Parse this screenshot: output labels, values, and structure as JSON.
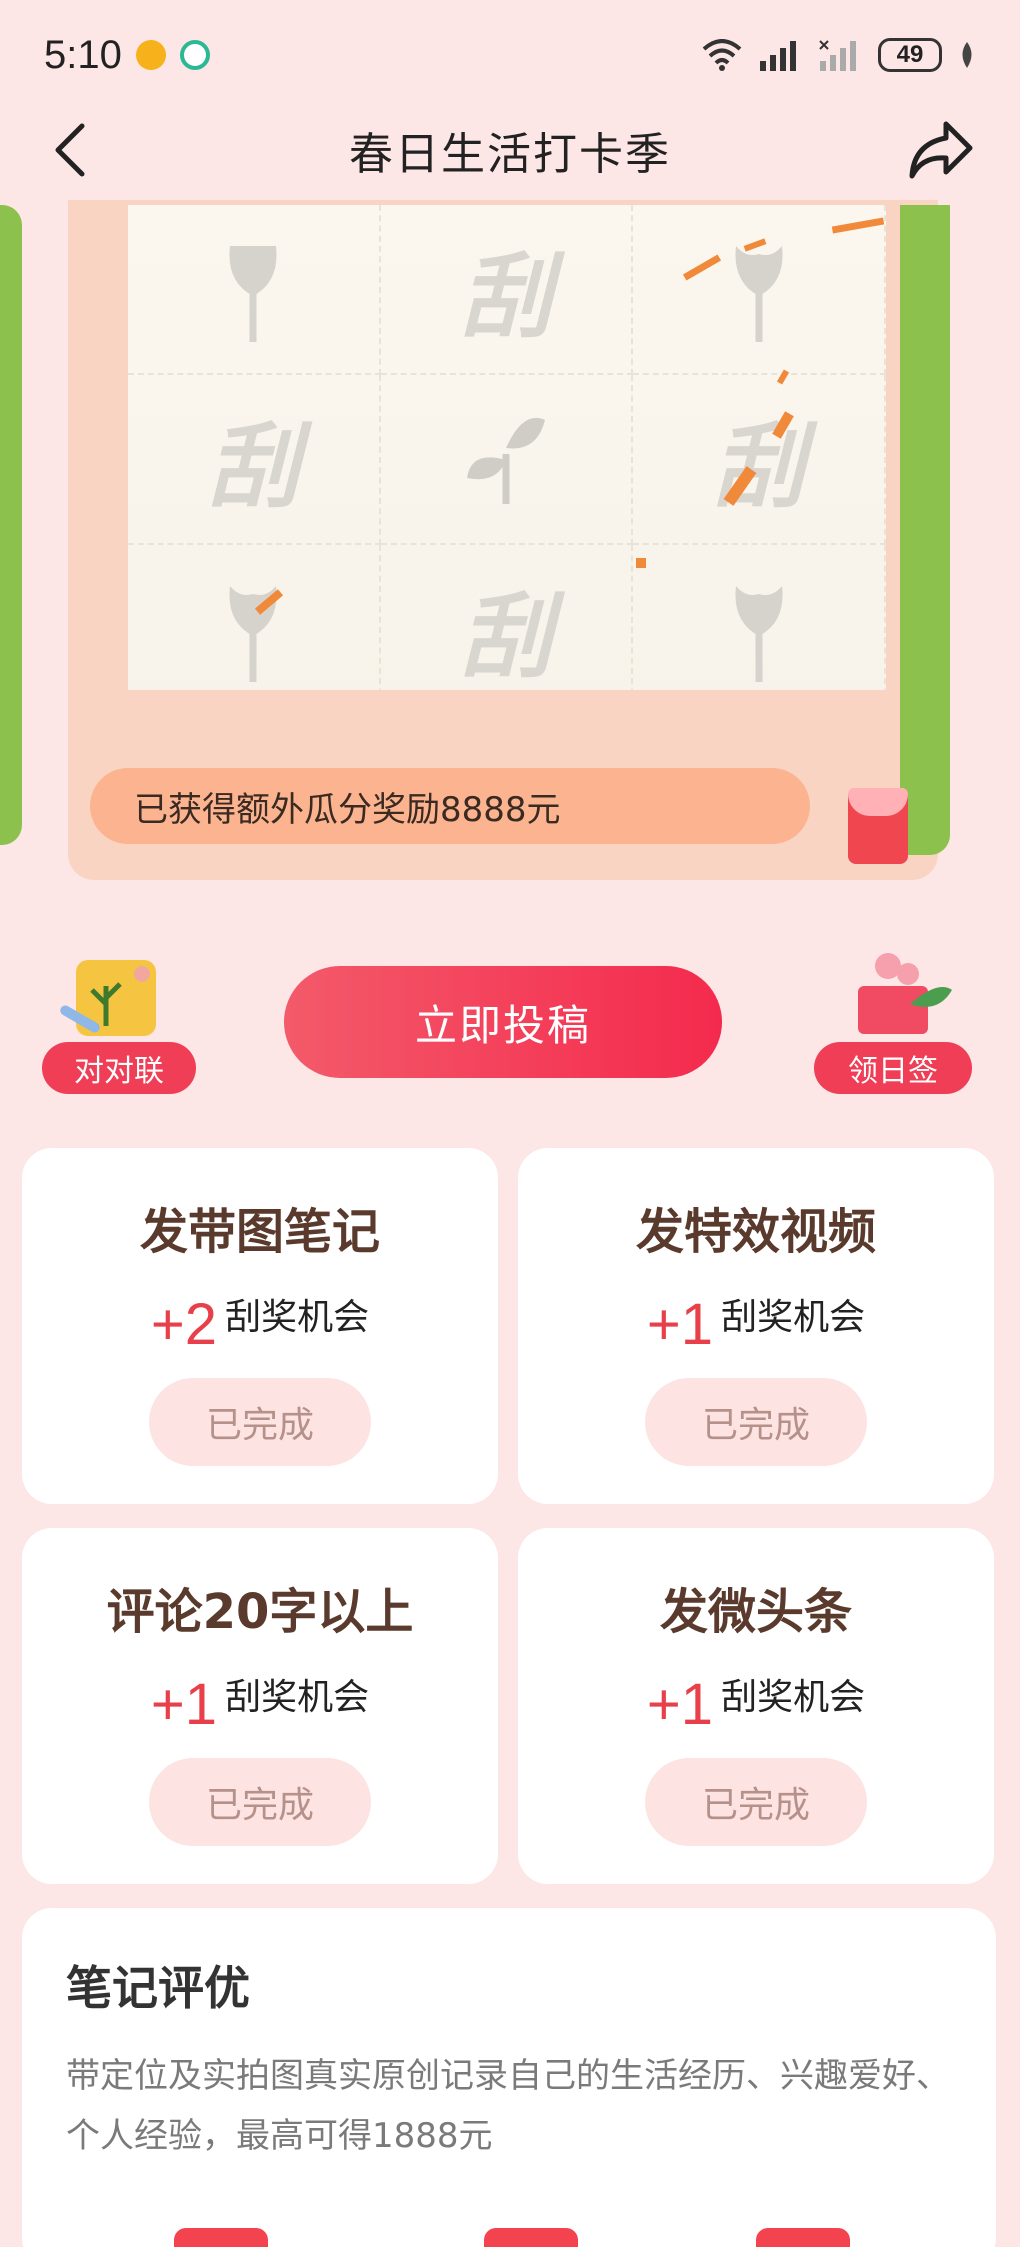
{
  "status": {
    "time": "5:10",
    "battery": "49"
  },
  "nav": {
    "title": "春日生活打卡季"
  },
  "scratch": {
    "cells": [
      "",
      "刮",
      "",
      "刮",
      "",
      "刮",
      "",
      "刮",
      ""
    ],
    "reward_text": "已获得额外瓜分奖励8888元"
  },
  "actions": {
    "left_badge": "对对联",
    "submit": "立即投稿",
    "right_badge": "领日签"
  },
  "tasks": [
    {
      "title": "发带图笔记",
      "plus": "+2",
      "label": "刮奖机会",
      "status": "已完成"
    },
    {
      "title": "发特效视频",
      "plus": "+1",
      "label": "刮奖机会",
      "status": "已完成"
    },
    {
      "title": "评论20字以上",
      "plus": "+1",
      "label": "刮奖机会",
      "status": "已完成"
    },
    {
      "title": "发微头条",
      "plus": "+1",
      "label": "刮奖机会",
      "status": "已完成"
    }
  ],
  "evaluation": {
    "title": "笔记评优",
    "desc": "带定位及实拍图真实原创记录自己的生活经历、兴趣爱好、个人经验，最高可得1888元"
  },
  "colors": {
    "page_bg": "#fde6e6",
    "accent_red": "#f42a4d",
    "plus_red": "#e8404a",
    "card_green": "#8cc14d",
    "reward_pill": "#fbb48f"
  }
}
